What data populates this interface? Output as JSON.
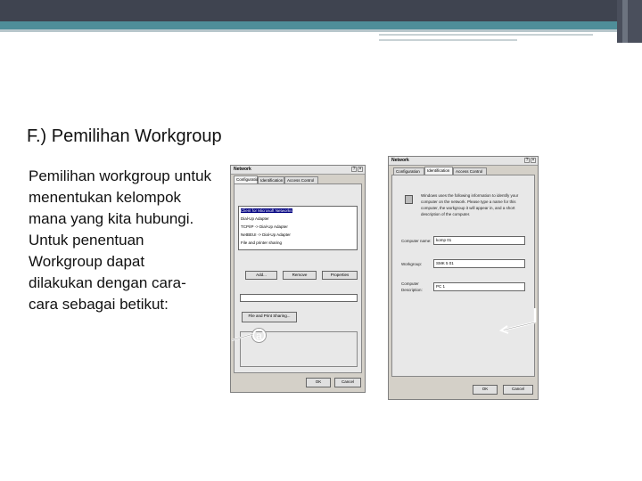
{
  "slide": {
    "title": "F.) Pemilihan Workgroup",
    "body": "Pemilihan workgroup untuk menentukan kelompok mana yang kita hubungi. Untuk penentuan Workgroup dapat dilakukan dengan cara-cara sebagai betikut:"
  },
  "left_dialog": {
    "title": "Network",
    "title_controls": [
      "?",
      "×"
    ],
    "tabs": [
      "Configuration",
      "Identification",
      "Access Control"
    ],
    "list_items": [
      "Client for Microsoft Networks",
      "Dial-Up Adapter",
      "TCP/IP -> Dial-Up Adapter",
      "NetBEUI -> Dial-Up Adapter",
      "File and printer sharing"
    ],
    "buttons": [
      "Add...",
      "Remove",
      "Properties"
    ],
    "file_share_button": "File and Print Sharing...",
    "ok_label": "OK",
    "cancel_label": "Cancel",
    "marker_label": "a"
  },
  "right_dialog": {
    "title": "Network",
    "title_controls": [
      "?",
      "×"
    ],
    "tabs": [
      "Configuration",
      "Identification",
      "Access Control"
    ],
    "description": "Windows uses the following information to identify your computer on the network. Please type a name for this computer, the workgroup it will appear in, and a short description of the computer.",
    "computer_name_label": "Computer name:",
    "computer_name_value": "komp 01",
    "workgroup_label": "Workgroup:",
    "workgroup_value": "SMK 5 01",
    "description_label": "Computer Description:",
    "description_value": "PC 1",
    "ok_label": "OK",
    "cancel_label": "Cancel"
  }
}
